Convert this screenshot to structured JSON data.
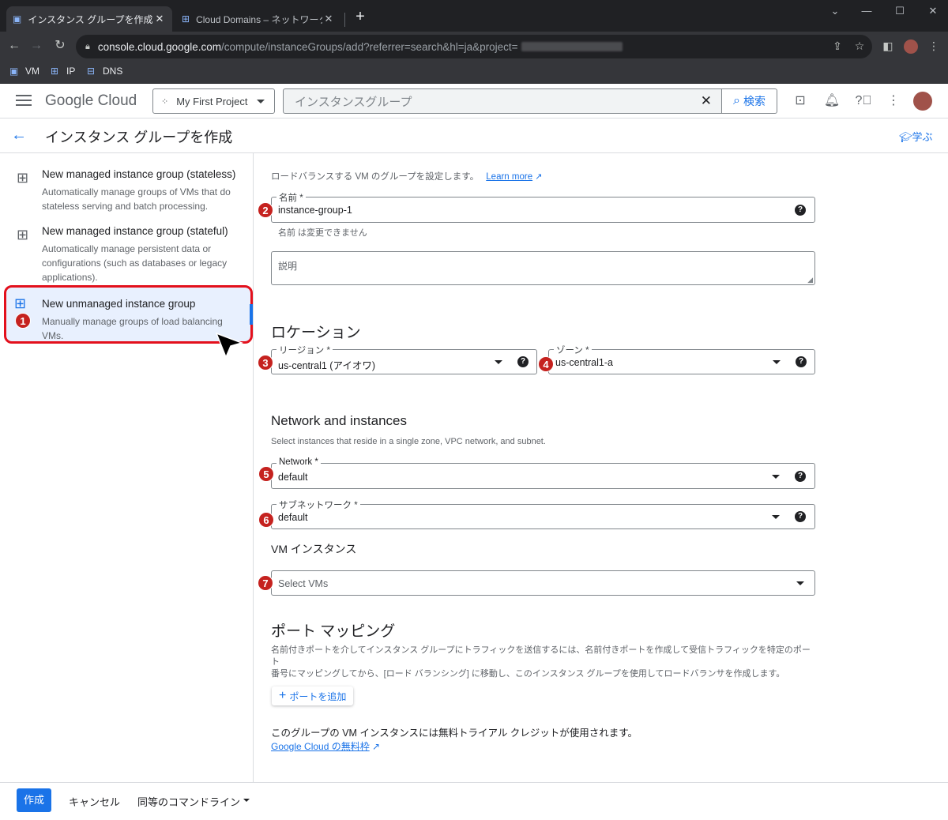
{
  "browser": {
    "tabs": [
      {
        "title": "インスタンス グループを作成 – Compu",
        "close": "✕"
      },
      {
        "title": "Cloud Domains – ネットワーク サービ",
        "close": "✕"
      }
    ],
    "new_tab": "+",
    "url_host": "console.cloud.google.com",
    "url_path": "/compute/instanceGroups/add?referrer=search&hl=ja&project=",
    "bookmarks": [
      {
        "label": "VM",
        "icon": "chip-icon"
      },
      {
        "label": "IP",
        "icon": "network-icon"
      },
      {
        "label": "DNS",
        "icon": "dns-icon"
      }
    ]
  },
  "header": {
    "logo_google": "Google",
    "logo_cloud": "Cloud",
    "project": "My First Project",
    "search_value": "インスタンスグループ",
    "search_button": "検索"
  },
  "page": {
    "title": "インスタンス グループを作成",
    "learn": "学ぶ"
  },
  "sidebar": {
    "options": [
      {
        "heading": "New managed instance group (stateless)",
        "desc": "Automatically manage groups of VMs that do stateless serving and batch processing."
      },
      {
        "heading": "New managed instance group (stateful)",
        "desc": "Automatically manage persistent data or configurations (such as databases or legacy applications)."
      },
      {
        "heading": "New unmanaged instance group",
        "desc": "Manually manage groups of load balancing VMs."
      }
    ]
  },
  "form": {
    "intro": "ロードバランスする VM のグループを設定します。",
    "learn_more": "Learn more",
    "name_label": "名前 *",
    "name_value": "instance-group-1",
    "name_hint": "名前 は変更できません",
    "desc_placeholder": "説明",
    "location_heading": "ロケーション",
    "region_label": "リージョン *",
    "region_value": "us-central1 (アイオワ)",
    "zone_label": "ゾーン *",
    "zone_value": "us-central1-a",
    "network_heading": "Network and instances",
    "network_desc": "Select instances that reside in a single zone, VPC network, and subnet.",
    "network_label": "Network *",
    "network_value": "default",
    "subnet_label": "サブネットワーク *",
    "subnet_value": "default",
    "vm_heading": "VM インスタンス",
    "vm_placeholder": "Select VMs",
    "port_heading": "ポート マッピング",
    "port_desc1": "名前付きポートを介してインスタンス グループにトラフィックを送信するには、名前付きポートを作成して受信トラフィックを特定のポート",
    "port_desc2": "番号にマッピングしてから、[ロード バランシング] に移動し、このインスタンス グループを使用してロードバランサを作成します。",
    "add_port": "ポートを追加",
    "trial_text": "このグループの VM インスタンスには無料トライアル クレジットが使用されます。",
    "free_tier_link": "Google Cloud の無料枠"
  },
  "badges": [
    "1",
    "2",
    "3",
    "4",
    "5",
    "6",
    "7"
  ],
  "footer": {
    "create": "作成",
    "cancel": "キャンセル",
    "command_line": "同等のコマンドライン"
  }
}
